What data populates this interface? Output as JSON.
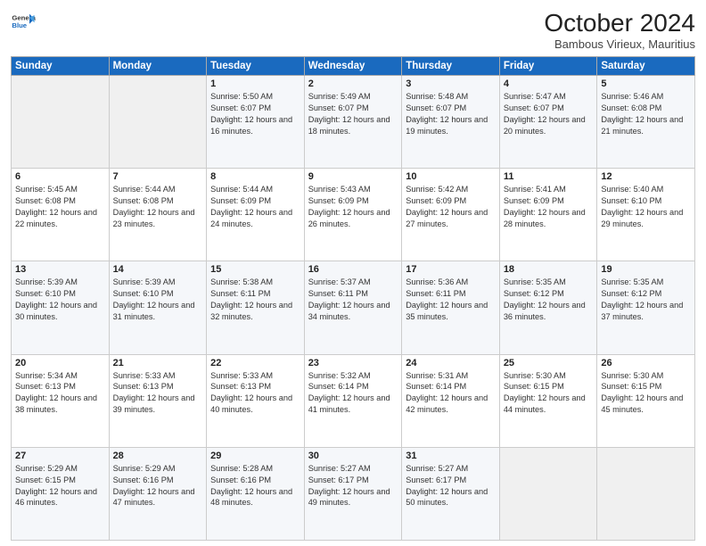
{
  "header": {
    "logo_general": "General",
    "logo_blue": "Blue",
    "month_year": "October 2024",
    "location": "Bambous Virieux, Mauritius"
  },
  "weekdays": [
    "Sunday",
    "Monday",
    "Tuesday",
    "Wednesday",
    "Thursday",
    "Friday",
    "Saturday"
  ],
  "weeks": [
    [
      {
        "day": "",
        "info": ""
      },
      {
        "day": "",
        "info": ""
      },
      {
        "day": "1",
        "info": "Sunrise: 5:50 AM\nSunset: 6:07 PM\nDaylight: 12 hours and 16 minutes."
      },
      {
        "day": "2",
        "info": "Sunrise: 5:49 AM\nSunset: 6:07 PM\nDaylight: 12 hours and 18 minutes."
      },
      {
        "day": "3",
        "info": "Sunrise: 5:48 AM\nSunset: 6:07 PM\nDaylight: 12 hours and 19 minutes."
      },
      {
        "day": "4",
        "info": "Sunrise: 5:47 AM\nSunset: 6:07 PM\nDaylight: 12 hours and 20 minutes."
      },
      {
        "day": "5",
        "info": "Sunrise: 5:46 AM\nSunset: 6:08 PM\nDaylight: 12 hours and 21 minutes."
      }
    ],
    [
      {
        "day": "6",
        "info": "Sunrise: 5:45 AM\nSunset: 6:08 PM\nDaylight: 12 hours and 22 minutes."
      },
      {
        "day": "7",
        "info": "Sunrise: 5:44 AM\nSunset: 6:08 PM\nDaylight: 12 hours and 23 minutes."
      },
      {
        "day": "8",
        "info": "Sunrise: 5:44 AM\nSunset: 6:09 PM\nDaylight: 12 hours and 24 minutes."
      },
      {
        "day": "9",
        "info": "Sunrise: 5:43 AM\nSunset: 6:09 PM\nDaylight: 12 hours and 26 minutes."
      },
      {
        "day": "10",
        "info": "Sunrise: 5:42 AM\nSunset: 6:09 PM\nDaylight: 12 hours and 27 minutes."
      },
      {
        "day": "11",
        "info": "Sunrise: 5:41 AM\nSunset: 6:09 PM\nDaylight: 12 hours and 28 minutes."
      },
      {
        "day": "12",
        "info": "Sunrise: 5:40 AM\nSunset: 6:10 PM\nDaylight: 12 hours and 29 minutes."
      }
    ],
    [
      {
        "day": "13",
        "info": "Sunrise: 5:39 AM\nSunset: 6:10 PM\nDaylight: 12 hours and 30 minutes."
      },
      {
        "day": "14",
        "info": "Sunrise: 5:39 AM\nSunset: 6:10 PM\nDaylight: 12 hours and 31 minutes."
      },
      {
        "day": "15",
        "info": "Sunrise: 5:38 AM\nSunset: 6:11 PM\nDaylight: 12 hours and 32 minutes."
      },
      {
        "day": "16",
        "info": "Sunrise: 5:37 AM\nSunset: 6:11 PM\nDaylight: 12 hours and 34 minutes."
      },
      {
        "day": "17",
        "info": "Sunrise: 5:36 AM\nSunset: 6:11 PM\nDaylight: 12 hours and 35 minutes."
      },
      {
        "day": "18",
        "info": "Sunrise: 5:35 AM\nSunset: 6:12 PM\nDaylight: 12 hours and 36 minutes."
      },
      {
        "day": "19",
        "info": "Sunrise: 5:35 AM\nSunset: 6:12 PM\nDaylight: 12 hours and 37 minutes."
      }
    ],
    [
      {
        "day": "20",
        "info": "Sunrise: 5:34 AM\nSunset: 6:13 PM\nDaylight: 12 hours and 38 minutes."
      },
      {
        "day": "21",
        "info": "Sunrise: 5:33 AM\nSunset: 6:13 PM\nDaylight: 12 hours and 39 minutes."
      },
      {
        "day": "22",
        "info": "Sunrise: 5:33 AM\nSunset: 6:13 PM\nDaylight: 12 hours and 40 minutes."
      },
      {
        "day": "23",
        "info": "Sunrise: 5:32 AM\nSunset: 6:14 PM\nDaylight: 12 hours and 41 minutes."
      },
      {
        "day": "24",
        "info": "Sunrise: 5:31 AM\nSunset: 6:14 PM\nDaylight: 12 hours and 42 minutes."
      },
      {
        "day": "25",
        "info": "Sunrise: 5:30 AM\nSunset: 6:15 PM\nDaylight: 12 hours and 44 minutes."
      },
      {
        "day": "26",
        "info": "Sunrise: 5:30 AM\nSunset: 6:15 PM\nDaylight: 12 hours and 45 minutes."
      }
    ],
    [
      {
        "day": "27",
        "info": "Sunrise: 5:29 AM\nSunset: 6:15 PM\nDaylight: 12 hours and 46 minutes."
      },
      {
        "day": "28",
        "info": "Sunrise: 5:29 AM\nSunset: 6:16 PM\nDaylight: 12 hours and 47 minutes."
      },
      {
        "day": "29",
        "info": "Sunrise: 5:28 AM\nSunset: 6:16 PM\nDaylight: 12 hours and 48 minutes."
      },
      {
        "day": "30",
        "info": "Sunrise: 5:27 AM\nSunset: 6:17 PM\nDaylight: 12 hours and 49 minutes."
      },
      {
        "day": "31",
        "info": "Sunrise: 5:27 AM\nSunset: 6:17 PM\nDaylight: 12 hours and 50 minutes."
      },
      {
        "day": "",
        "info": ""
      },
      {
        "day": "",
        "info": ""
      }
    ]
  ]
}
